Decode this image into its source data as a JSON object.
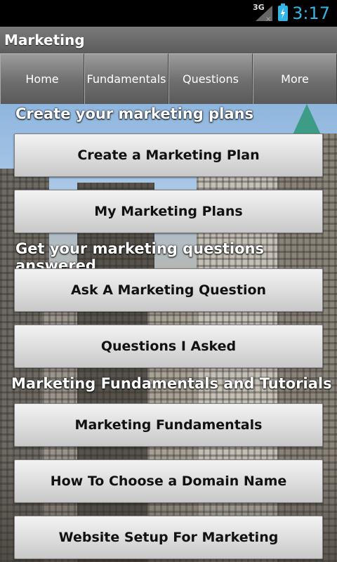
{
  "status_bar": {
    "network": "3G",
    "time": "3:17",
    "icons": [
      "signal-icon",
      "battery-charging-icon"
    ]
  },
  "app": {
    "title": "Marketing"
  },
  "tabs": [
    {
      "label": "Home"
    },
    {
      "label": "Fundamentals"
    },
    {
      "label": "Questions"
    },
    {
      "label": "More"
    }
  ],
  "sections": [
    {
      "heading": "Create your marketing plans",
      "buttons": [
        "Create a Marketing Plan",
        "My Marketing Plans"
      ]
    },
    {
      "heading": "Get your marketing questions answered",
      "buttons": [
        "Ask A Marketing Question",
        "Questions I Asked"
      ]
    },
    {
      "heading": "Marketing Fundamentals and Tutorials",
      "buttons": [
        "Marketing Fundamentals",
        "How To Choose a Domain Name",
        "Website Setup For Marketing"
      ]
    }
  ],
  "colors": {
    "accent": "#33b5e5",
    "titlebar": "#6b6b6b"
  }
}
